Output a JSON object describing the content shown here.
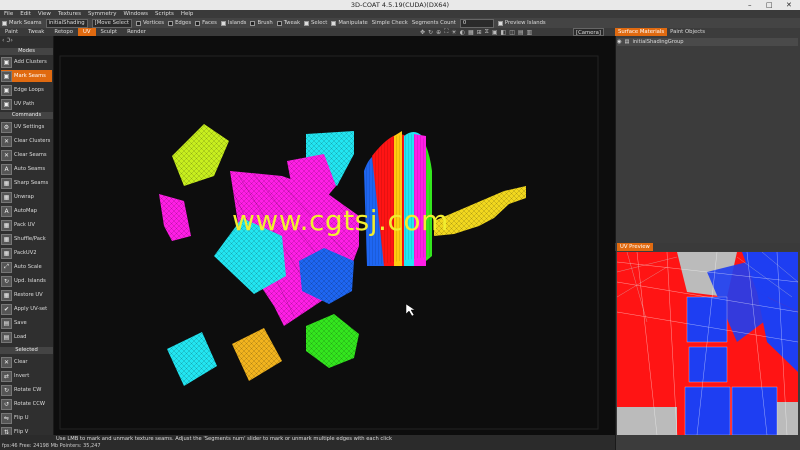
{
  "window": {
    "title": "3D-COAT 4.5.19(CUDA)(DX64)",
    "minimize": "–",
    "maximize": "□",
    "close": "✕"
  },
  "menu": [
    "File",
    "Edit",
    "View",
    "Textures",
    "Symmetry",
    "Windows",
    "Scripts",
    "Help"
  ],
  "toolbar": {
    "mode_label": "Mark Seams",
    "shading_value": "initialShading",
    "move_select_value": "[Move Select",
    "vertices": "Vertices",
    "edges": "Edges",
    "faces": "Faces",
    "islands": "Islands",
    "brush": "Brush",
    "tweak": "Tweak",
    "select": "Select",
    "manipulate": "Manipulate",
    "simple_check": "Simple Check",
    "segments_count_label": "Segments Count",
    "segments_count_value": "0",
    "preview_islands": "Preview Islands"
  },
  "room_tabs": [
    {
      "label": "Paint",
      "active": false
    },
    {
      "label": "Tweak",
      "active": false
    },
    {
      "label": "Retopo",
      "active": false
    },
    {
      "label": "UV",
      "active": true
    },
    {
      "label": "Sculpt",
      "active": false
    },
    {
      "label": "Render",
      "active": false
    }
  ],
  "camera": "[Camera]",
  "left_panel": {
    "modes_header": "Modes",
    "modes": [
      {
        "label": "Add Clusters",
        "icon": "add-clusters-icon",
        "glyph": "▣",
        "active": false
      },
      {
        "label": "Mark Seams",
        "icon": "mark-seams-icon",
        "glyph": "▣",
        "active": true
      },
      {
        "label": "Edge Loops",
        "icon": "edge-loops-icon",
        "glyph": "▣",
        "active": false
      },
      {
        "label": "UV Path",
        "icon": "uv-path-icon",
        "glyph": "▣",
        "active": false
      }
    ],
    "commands_header": "Commands",
    "commands": [
      {
        "label": "UV Settings",
        "icon": "settings-icon",
        "glyph": "⚙"
      },
      {
        "label": "Clear Clusters",
        "icon": "clear-clusters-icon",
        "glyph": "✕"
      },
      {
        "label": "Clear Seams",
        "icon": "clear-seams-icon",
        "glyph": "✕"
      },
      {
        "label": "Auto Seams",
        "icon": "auto-seams-icon",
        "glyph": "A"
      },
      {
        "label": "Sharp Seams",
        "icon": "sharp-seams-icon",
        "glyph": "▦"
      },
      {
        "label": "Unwrap",
        "icon": "unwrap-icon",
        "glyph": "▦"
      },
      {
        "label": "AutoMap",
        "icon": "automap-icon",
        "glyph": "A"
      },
      {
        "label": "Pack UV",
        "icon": "pack-uv-icon",
        "glyph": "▦"
      },
      {
        "label": "Shuffle/Pack",
        "icon": "shuffle-pack-icon",
        "glyph": "▦"
      },
      {
        "label": "PackUV2",
        "icon": "pack-uv2-icon",
        "glyph": "▦"
      },
      {
        "label": "Auto Scale",
        "icon": "auto-scale-icon",
        "glyph": "⤢"
      },
      {
        "label": "Upd. Islands",
        "icon": "update-islands-icon",
        "glyph": "↻"
      },
      {
        "label": "Restore UV",
        "icon": "restore-uv-icon",
        "glyph": "▦"
      },
      {
        "label": "Apply UV-set",
        "icon": "apply-uv-set-icon",
        "glyph": "✔"
      },
      {
        "label": "Save",
        "icon": "save-icon",
        "glyph": "▤"
      },
      {
        "label": "Load",
        "icon": "load-icon",
        "glyph": "▤"
      }
    ],
    "selected_header": "Selected",
    "selected": [
      {
        "label": "Clear",
        "icon": "clear-icon",
        "glyph": "✕"
      },
      {
        "label": "Invert",
        "icon": "invert-icon",
        "glyph": "⇄"
      },
      {
        "label": "Rotate CW",
        "icon": "rotate-cw-icon",
        "glyph": "↻"
      },
      {
        "label": "Rotate CCW",
        "icon": "rotate-ccw-icon",
        "glyph": "↺"
      },
      {
        "label": "Flip U",
        "icon": "flip-u-icon",
        "glyph": "⇋"
      },
      {
        "label": "Flip V",
        "icon": "flip-v-icon",
        "glyph": "⇅"
      }
    ]
  },
  "viewport": {
    "watermark": "www.cgtsj.com"
  },
  "status": {
    "fps": "fps:46",
    "free_label": "Free:",
    "free_value": "24198 Mb",
    "pointers": "Pointers: 35,247",
    "message": "Use LMB to mark and unmark texture seams. Adjust the 'Segments num' slider to mark or unmark multiple edges with each click"
  },
  "right_panel": {
    "tabs": [
      {
        "label": "Surface Materials",
        "active": true
      },
      {
        "label": "Paint Objects",
        "active": false
      }
    ],
    "material_name": "initialShadingGroup",
    "uv_preview_label": "UV Preview"
  },
  "colors": {
    "accent": "#e06a10",
    "magenta": "#ff1ee6",
    "cyan": "#22e6f2",
    "yellow": "#f2ee30",
    "green": "#33e61e",
    "blue": "#1e66f2",
    "red": "#ff1414"
  }
}
